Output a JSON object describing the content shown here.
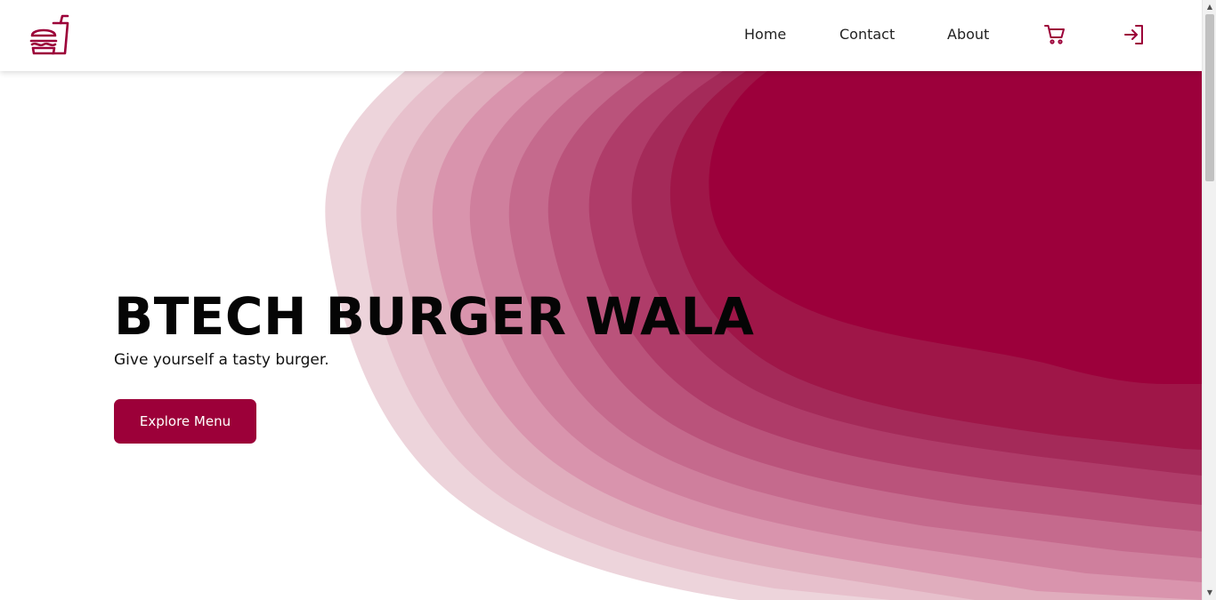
{
  "brand": {
    "logo_icon": "burger-and-drink-icon",
    "accent_color": "#9c0039"
  },
  "nav": {
    "home": "Home",
    "contact": "Contact",
    "about": "About",
    "cart_icon": "cart-icon",
    "login_icon": "login-icon"
  },
  "hero": {
    "title": "BTECH BURGER WALA",
    "subtitle": "Give yourself a tasty burger.",
    "cta_label": "Explore Menu"
  },
  "scrollbar": {
    "up": "▲",
    "down": "▼"
  }
}
